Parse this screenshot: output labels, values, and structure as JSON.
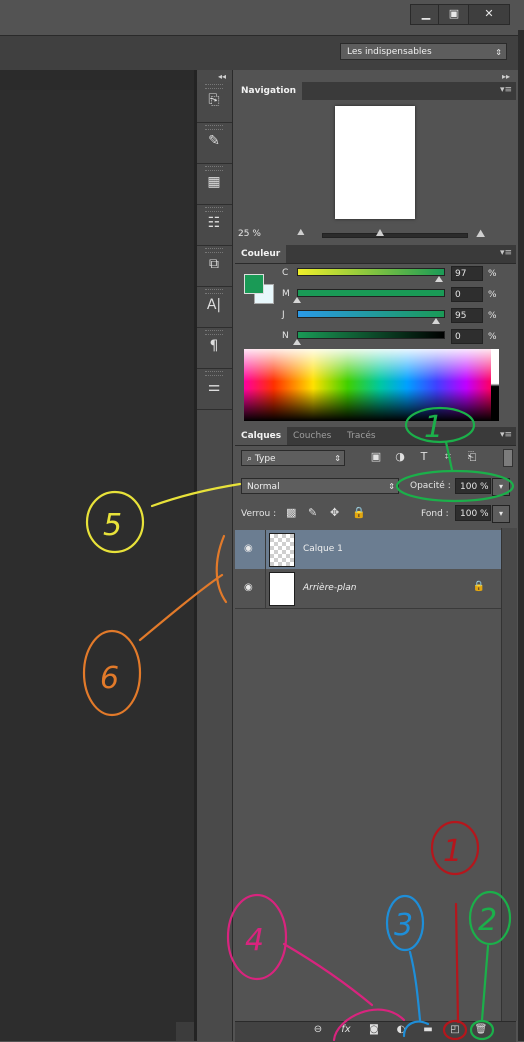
{
  "window": {
    "buttons": {
      "minimize": "▁",
      "maximize": "▣",
      "close": "✕"
    }
  },
  "options_bar": {
    "workspace": {
      "value": "Les indispensables",
      "arrow": "⇕"
    }
  },
  "tools_panel": {
    "collapse_glyph": "◂◂",
    "icons": [
      {
        "name": "history-icon",
        "glyph": "⎘"
      },
      {
        "name": "brush-presets-icon",
        "glyph": "✎"
      },
      {
        "name": "brush-panel-icon",
        "glyph": "▦"
      },
      {
        "name": "properties-icon",
        "glyph": "☷"
      },
      {
        "name": "clone-source-icon",
        "glyph": "⧉"
      },
      {
        "name": "character-icon",
        "glyph": "A|"
      },
      {
        "name": "paragraph-icon",
        "glyph": "¶"
      },
      {
        "name": "adjustments-icon",
        "glyph": "⚌"
      }
    ]
  },
  "panels_collapse": "▸▸",
  "navigation": {
    "tab": "Navigation",
    "menu": "▾≡",
    "zoom": "25 %",
    "zoom_out": "⛰",
    "zoom_in": "⛰",
    "zoom_fraction": 0.4
  },
  "color": {
    "tab": "Couleur",
    "menu": "▾≡",
    "foreground": "#1a9a56",
    "background": "#e8f8fc",
    "channels": [
      {
        "label": "C",
        "value": "97",
        "unit": "%",
        "fraction": 0.97
      },
      {
        "label": "M",
        "value": "0",
        "unit": "%",
        "fraction": 0.0
      },
      {
        "label": "J",
        "value": "95",
        "unit": "%",
        "fraction": 0.95
      },
      {
        "label": "N",
        "value": "0",
        "unit": "%",
        "fraction": 0.0
      }
    ]
  },
  "layers": {
    "tabs": [
      "Calques",
      "Couches",
      "Tracés"
    ],
    "menu": "▾≡",
    "filter": {
      "value": "Type",
      "search_glyph": "⌕",
      "arrow": "⇕"
    },
    "filter_icons": [
      {
        "name": "pixel-filter-icon",
        "glyph": "▣"
      },
      {
        "name": "adjustment-filter-icon",
        "glyph": "◑"
      },
      {
        "name": "text-filter-icon",
        "glyph": "T"
      },
      {
        "name": "shape-filter-icon",
        "glyph": "⌗"
      },
      {
        "name": "smart-object-filter-icon",
        "glyph": "⎗"
      }
    ],
    "blend_mode": {
      "value": "Normal",
      "arrow": "⇕"
    },
    "opacity": {
      "label": "Opacité :",
      "value": "100 %",
      "arrow": "▾"
    },
    "lock": {
      "label": "Verrou :",
      "icons": [
        {
          "name": "lock-transparency-icon",
          "glyph": "▩"
        },
        {
          "name": "lock-image-icon",
          "glyph": "✎"
        },
        {
          "name": "lock-position-icon",
          "glyph": "✥"
        },
        {
          "name": "lock-all-icon",
          "glyph": "🔒"
        }
      ]
    },
    "fill": {
      "label": "Fond :",
      "value": "100 %",
      "arrow": "▾"
    },
    "rows": [
      {
        "name": "Calque 1",
        "eye": "◉",
        "selected": true,
        "transparent": true,
        "locked": false
      },
      {
        "name": "Arrière-plan",
        "eye": "◉",
        "selected": false,
        "transparent": false,
        "locked": true,
        "lock_glyph": "🔒"
      }
    ],
    "footer_icons": [
      {
        "name": "link-layers-icon",
        "glyph": "⊖"
      },
      {
        "name": "layer-style-icon",
        "glyph": "fx"
      },
      {
        "name": "layer-mask-icon",
        "glyph": "◙"
      },
      {
        "name": "adjustment-layer-icon",
        "glyph": "◐"
      },
      {
        "name": "new-group-icon",
        "glyph": "▬"
      },
      {
        "name": "new-layer-icon",
        "glyph": "◰"
      },
      {
        "name": "delete-layer-icon",
        "glyph": "🗑"
      }
    ]
  },
  "annotations": {
    "colors": {
      "green": "#1bb04a",
      "yellow": "#e8e23a",
      "orange": "#e27a2a",
      "red": "#b5161c",
      "blue": "#1e8ed8",
      "pink": "#d8247e"
    },
    "labels": [
      "1",
      "1",
      "2",
      "3",
      "4",
      "5",
      "6"
    ]
  }
}
